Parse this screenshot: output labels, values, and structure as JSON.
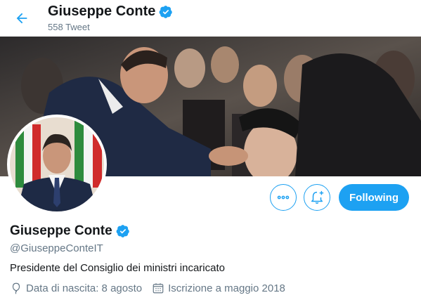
{
  "header": {
    "title": "Giuseppe Conte",
    "tweet_count": "558 Tweet"
  },
  "profile": {
    "name": "Giuseppe Conte",
    "handle": "@GiuseppeConteIT",
    "bio": "Presidente del Consiglio dei ministri incaricato",
    "birthdate": "Data di nascita: 8 agosto",
    "joined": "Iscrizione a maggio 2018"
  },
  "actions": {
    "following_label": "Following"
  },
  "colors": {
    "accent": "#1da1f2",
    "text": "#14171a",
    "secondary": "#657786"
  },
  "icons": {
    "back": "arrow-left-icon",
    "verified": "verified-badge-icon",
    "more": "more-icon",
    "notify": "bell-plus-icon",
    "birthday": "balloon-icon",
    "calendar": "calendar-icon"
  }
}
